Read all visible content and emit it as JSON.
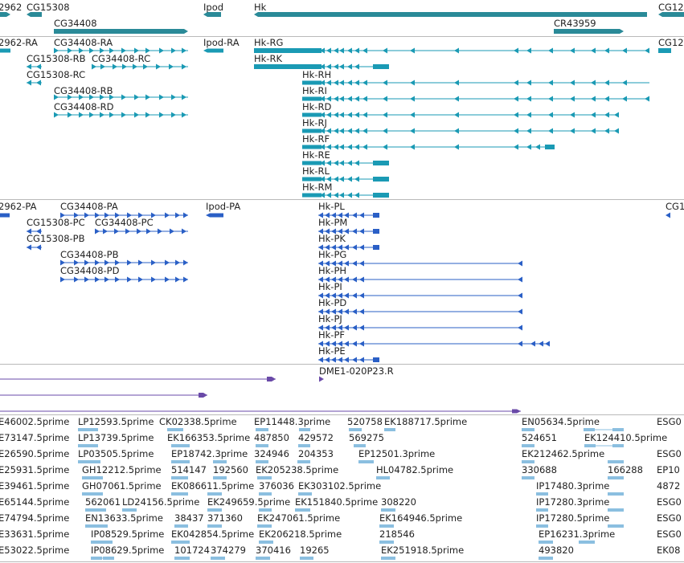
{
  "colors": {
    "gene": "#2a8a98",
    "transcript": "#1a9ab4",
    "protein": "#2a5fc6",
    "pfam": "#6a4aa8",
    "est": "#8bbfe0",
    "separator": "#b9b9b9",
    "label": "#222222"
  },
  "genes_track": {
    "labels": [
      "2962",
      "CG15308",
      "CG34408",
      "Ipod",
      "Hk",
      "CR43959",
      "CG12"
    ]
  },
  "transcripts_track": {
    "labels": [
      "2962-RA",
      "CG34408-RA",
      "Ipod-RA",
      "Hk-RG",
      "CG12",
      "CG15308-RB",
      "CG34408-RC",
      "Hk-RK",
      "CG15308-RC",
      "Hk-RH",
      "CG34408-RB",
      "Hk-RI",
      "CG34408-RD",
      "Hk-RD",
      "Hk-RJ",
      "Hk-RF",
      "Hk-RE",
      "Hk-RL",
      "Hk-RM"
    ]
  },
  "proteins_track": {
    "labels": [
      "2962-PA",
      "CG34408-PA",
      "Ipod-PA",
      "Hk-PL",
      "CG1",
      "CG15308-PC",
      "CG34408-PC",
      "Hk-PM",
      "CG15308-PB",
      "Hk-PK",
      "CG34408-PB",
      "Hk-PG",
      "CG34408-PD",
      "Hk-PH",
      "Hk-PI",
      "Hk-PD",
      "Hk-PJ",
      "Hk-PF",
      "Hk-PE"
    ]
  },
  "features_track": {
    "labels": [
      "DME1-020P23.R"
    ]
  },
  "est_track": {
    "labels": [
      "E46002.5prime",
      "LP12593.5prime",
      "CK02338.5prime",
      "EP11448.3prime",
      "520758",
      "EK188717.5prime",
      "EN05634.5prime",
      "ESG0",
      "E73147.5prime",
      "LP13739.5prime",
      "EK166353.5prime",
      "487850",
      "429572",
      "569275",
      "524651",
      "EK124410.5prime",
      "E26590.5prime",
      "LP03505.5prime",
      "EP18742.3prime",
      "324946",
      "204353",
      "EP12501.3prime",
      "EK212462.5prime",
      "ESG0",
      "E25931.5prime",
      "GH12212.5prime",
      "514147",
      "192560",
      "EK205238.5prime",
      "HL04782.5prime",
      "330688",
      "166288",
      "EP10",
      "E39461.5prime",
      "GH07061.5prime",
      "EK086611.5prime",
      "376036",
      "EK303102.5prime",
      "IP17480.3prime",
      "4872",
      "E65144.5prime",
      "562061",
      "LD24156.5prime",
      "EK249659.5prime",
      "EK151840.5prime",
      "308220",
      "IP17280.3prime",
      "ESG0",
      "E74794.5prime",
      "EN13633.5prime",
      "38437",
      "371360",
      "EK247061.5prime",
      "EK164946.5prime",
      "IP17280.5prime",
      "ESG0",
      "E33631.5prime",
      "IP08529.5prime",
      "EK042854.5prime",
      "EK206218.5prime",
      "218546",
      "EP16231.3prime",
      "ESG0",
      "E53022.5prime",
      "IP08629.5prime",
      "101724",
      "374279",
      "370416",
      "19265",
      "EK251918.5prime",
      "493820",
      "EK08"
    ]
  }
}
